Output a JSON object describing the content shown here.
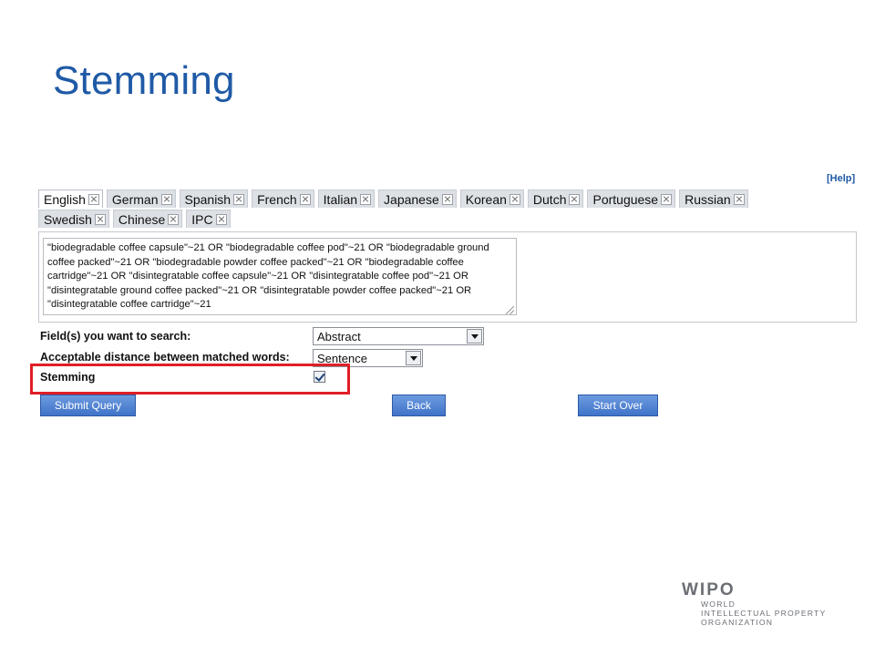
{
  "slide": {
    "title": "Stemming"
  },
  "help": {
    "label": "[Help]"
  },
  "tabs": {
    "row1": [
      "English",
      "German",
      "Spanish",
      "French",
      "Italian",
      "Japanese",
      "Korean",
      "Dutch",
      "Portuguese",
      "Russian"
    ],
    "row2": [
      "Swedish",
      "Chinese",
      "IPC"
    ],
    "active": "English"
  },
  "query": {
    "value": "\"biodegradable coffee capsule\"~21 OR \"biodegradable coffee pod\"~21 OR \"biodegradable ground coffee packed\"~21 OR \"biodegradable powder coffee packed\"~21 OR \"biodegradable coffee cartridge\"~21 OR \"disintegratable coffee capsule\"~21 OR \"disintegratable coffee pod\"~21 OR \"disintegratable ground coffee packed\"~21 OR \"disintegratable powder coffee packed\"~21 OR \"disintegratable coffee cartridge\"~21"
  },
  "form": {
    "fields_label": "Field(s) you want to search:",
    "fields_value": "Abstract",
    "distance_label": "Acceptable distance between matched words:",
    "distance_value": "Sentence",
    "stemming_label": "Stemming",
    "stemming_checked": true
  },
  "buttons": {
    "submit": "Submit Query",
    "back": "Back",
    "start_over": "Start Over"
  },
  "logo": {
    "mark": "WIPO",
    "line1": "WORLD",
    "line2": "INTELLECTUAL PROPERTY",
    "line3": "ORGANIZATION"
  },
  "colors": {
    "title": "#1f5aa6",
    "button": "#3f73c8",
    "highlight": "#e01e26"
  }
}
